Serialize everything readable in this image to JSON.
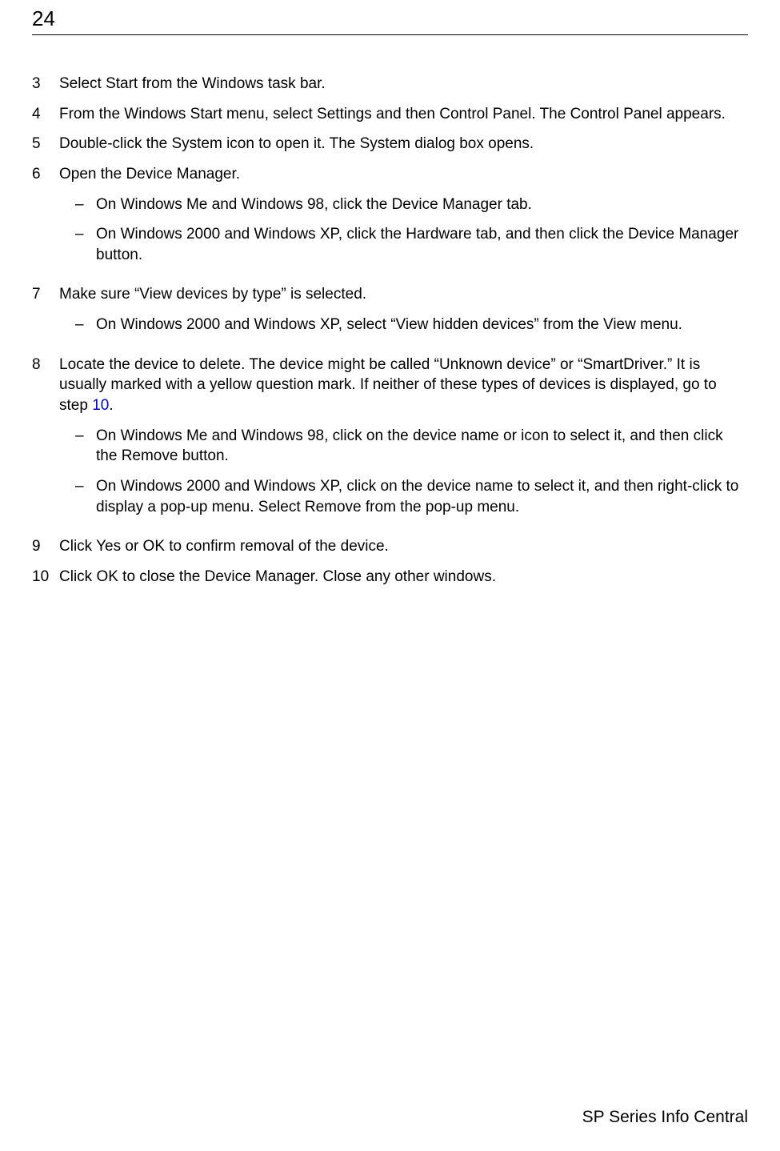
{
  "page_number": "24",
  "footer": "SP Series Info Central",
  "link_text": "10",
  "steps": [
    {
      "num": "3",
      "text": "Select Start from the Windows task bar."
    },
    {
      "num": "4",
      "text": "From the Windows Start menu, select Settings and then Control Panel. The Control Panel appears."
    },
    {
      "num": "5",
      "text": "Double-click the System icon to open it. The System dialog box opens."
    },
    {
      "num": "6",
      "text": "Open the Device Manager.",
      "subs": [
        "On Windows Me and Windows 98, click the Device Manager tab.",
        "On Windows 2000 and Windows XP, click the Hardware tab, and then click the Device Manager button."
      ]
    },
    {
      "num": "7",
      "text": "Make sure “View devices by type” is selected.",
      "subs": [
        "On Windows 2000 and Windows XP, select “View hidden devices” from the View menu."
      ]
    },
    {
      "num": "8",
      "text_pre": "Locate the device to delete. The device might be called “Unknown device” or “SmartDriver.” It is usually marked with a yellow question mark. If neither of these types of devices is displayed, go to step ",
      "text_post": ".",
      "has_link": true,
      "subs": [
        "On Windows Me and Windows 98, click on the device name or icon to select it, and then click the Remove button.",
        "On Windows 2000 and Windows XP, click on the device name to select it, and then right-click to display a pop-up menu. Select Remove from the pop-up menu."
      ]
    },
    {
      "num": "9",
      "text": "Click Yes or OK to confirm removal of the device."
    },
    {
      "num": "10",
      "text": "Click OK to close the Device Manager. Close any other windows."
    }
  ]
}
